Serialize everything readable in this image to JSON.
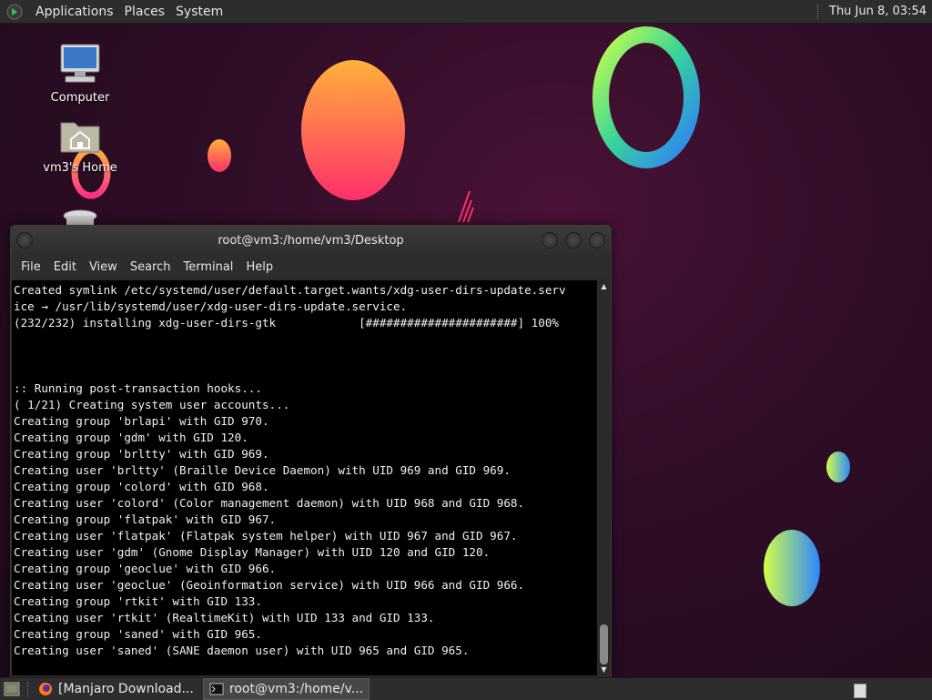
{
  "top_panel": {
    "menus": [
      "Applications",
      "Places",
      "System"
    ],
    "clock": "Thu Jun  8, 03:54"
  },
  "desktop": {
    "icons": [
      {
        "label": "Computer",
        "icon": "computer-icon"
      },
      {
        "label": "vm3's Home",
        "icon": "home-folder-icon"
      },
      {
        "label": "",
        "icon": "trash-icon"
      }
    ]
  },
  "terminal": {
    "title": "root@vm3:/home/vm3/Desktop",
    "menus": [
      "File",
      "Edit",
      "View",
      "Search",
      "Terminal",
      "Help"
    ],
    "lines": [
      "Created symlink /etc/systemd/user/default.target.wants/xdg-user-dirs-update.serv",
      "ice → /usr/lib/systemd/user/xdg-user-dirs-update.service.",
      "(232/232) installing xdg-user-dirs-gtk            [######################] 100%",
      "",
      "",
      "",
      ":: Running post-transaction hooks...",
      "( 1/21) Creating system user accounts...",
      "Creating group 'brlapi' with GID 970.",
      "Creating group 'gdm' with GID 120.",
      "Creating group 'brltty' with GID 969.",
      "Creating user 'brltty' (Braille Device Daemon) with UID 969 and GID 969.",
      "Creating group 'colord' with GID 968.",
      "Creating user 'colord' (Color management daemon) with UID 968 and GID 968.",
      "Creating group 'flatpak' with GID 967.",
      "Creating user 'flatpak' (Flatpak system helper) with UID 967 and GID 967.",
      "Creating user 'gdm' (Gnome Display Manager) with UID 120 and GID 120.",
      "Creating group 'geoclue' with GID 966.",
      "Creating user 'geoclue' (Geoinformation service) with UID 966 and GID 966.",
      "Creating group 'rtkit' with GID 133.",
      "Creating user 'rtkit' (RealtimeKit) with UID 133 and GID 133.",
      "Creating group 'saned' with GID 965.",
      "Creating user 'saned' (SANE daemon user) with UID 965 and GID 965."
    ]
  },
  "taskbar": {
    "items": [
      {
        "label": "[Manjaro Download...",
        "icon": "firefox-icon",
        "active": false
      },
      {
        "label": "root@vm3:/home/v...",
        "icon": "terminal-icon",
        "active": true
      }
    ]
  },
  "colors": {
    "panel": "#2d2d2d",
    "terminal_bg": "#000000",
    "desktop_bg": "#2e0d26"
  }
}
